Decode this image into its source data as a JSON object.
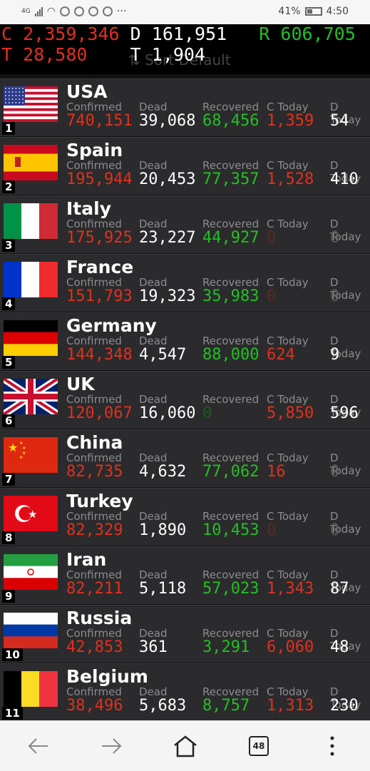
{
  "status": {
    "network": "4G",
    "battery": "41%",
    "time": "4:50",
    "more": "···"
  },
  "totals": {
    "c_label": "C",
    "c_value": "2,359,346",
    "d_label": "D",
    "d_value": "161,951",
    "r_label": "R",
    "r_value": "606,705",
    "t_label": "T",
    "t_value": "28,580",
    "t2_label": "T",
    "t2_value": "1,904",
    "sort_label": "Sort Default"
  },
  "labels": {
    "confirmed": "Confirmed",
    "dead": "Dead",
    "recovered": "Recovered",
    "c_today": "C Today",
    "d_today": "D Today"
  },
  "countries": [
    {
      "rank": "1",
      "name": "USA",
      "flag": "usa",
      "confirmed": "740,151",
      "dead": "39,068",
      "recovered": "68,456",
      "c_today": "1,359",
      "d_today": "54"
    },
    {
      "rank": "2",
      "name": "Spain",
      "flag": "spain",
      "confirmed": "195,944",
      "dead": "20,453",
      "recovered": "77,357",
      "c_today": "1,528",
      "d_today": "410"
    },
    {
      "rank": "3",
      "name": "Italy",
      "flag": "italy",
      "confirmed": "175,925",
      "dead": "23,227",
      "recovered": "44,927",
      "c_today": "0",
      "d_today": "0"
    },
    {
      "rank": "4",
      "name": "France",
      "flag": "france",
      "confirmed": "151,793",
      "dead": "19,323",
      "recovered": "35,983",
      "c_today": "0",
      "d_today": "0"
    },
    {
      "rank": "5",
      "name": "Germany",
      "flag": "germany",
      "confirmed": "144,348",
      "dead": "4,547",
      "recovered": "88,000",
      "c_today": "624",
      "d_today": "9"
    },
    {
      "rank": "6",
      "name": "UK",
      "flag": "uk",
      "confirmed": "120,067",
      "dead": "16,060",
      "recovered": "0",
      "c_today": "5,850",
      "d_today": "596"
    },
    {
      "rank": "7",
      "name": "China",
      "flag": "china",
      "confirmed": "82,735",
      "dead": "4,632",
      "recovered": "77,062",
      "c_today": "16",
      "d_today": "0"
    },
    {
      "rank": "8",
      "name": "Turkey",
      "flag": "turkey",
      "confirmed": "82,329",
      "dead": "1,890",
      "recovered": "10,453",
      "c_today": "0",
      "d_today": "0"
    },
    {
      "rank": "9",
      "name": "Iran",
      "flag": "iran",
      "confirmed": "82,211",
      "dead": "5,118",
      "recovered": "57,023",
      "c_today": "1,343",
      "d_today": "87"
    },
    {
      "rank": "10",
      "name": "Russia",
      "flag": "russia",
      "confirmed": "42,853",
      "dead": "361",
      "recovered": "3,291",
      "c_today": "6,060",
      "d_today": "48"
    },
    {
      "rank": "11",
      "name": "Belgium",
      "flag": "belgium",
      "confirmed": "38,496",
      "dead": "5,683",
      "recovered": "8,757",
      "c_today": "1,313",
      "d_today": "230"
    }
  ],
  "nav": {
    "tabs_count": "48"
  },
  "colors": {
    "confirmed": "#e0301e",
    "dead": "#ffffff",
    "recovered": "#22c022",
    "background": "#2b2b2d"
  }
}
